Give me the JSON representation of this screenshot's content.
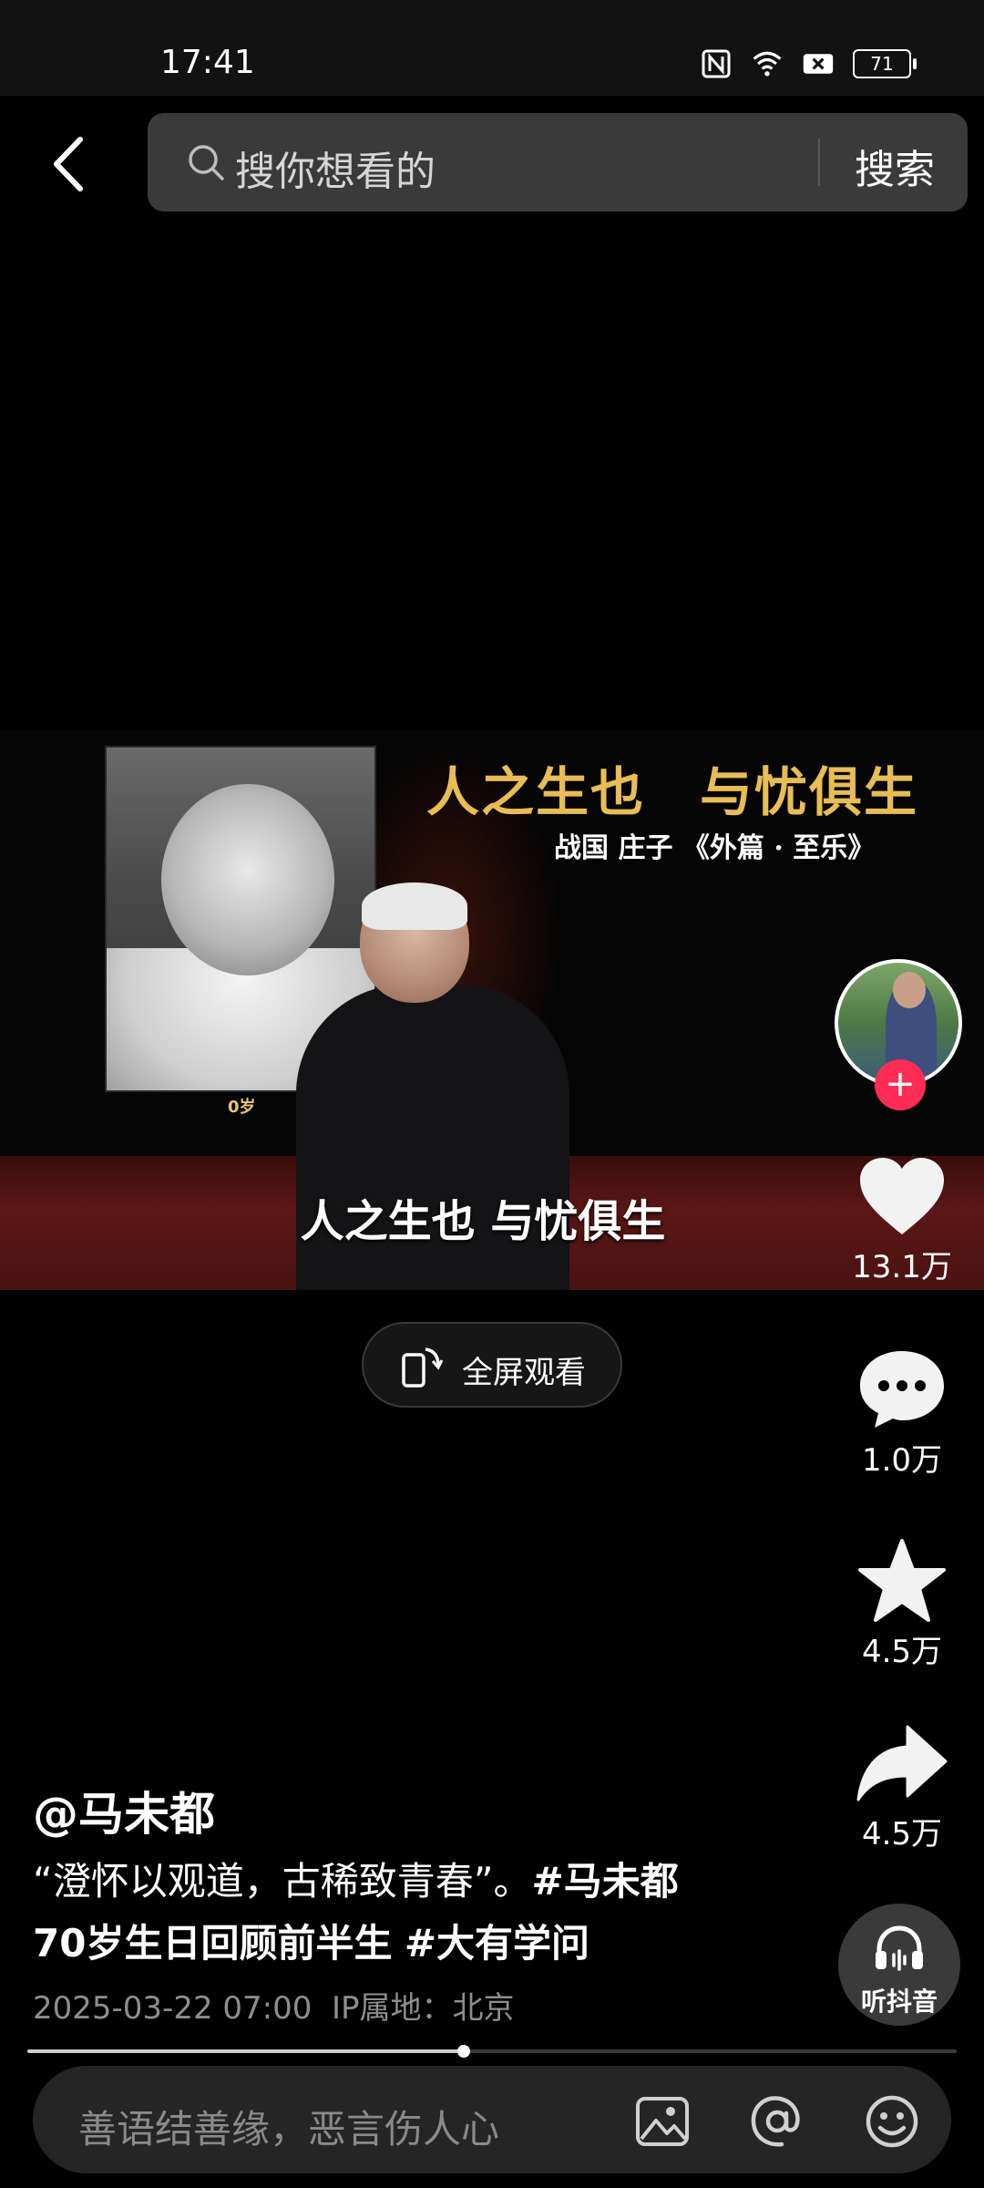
{
  "status": {
    "time": "17:41",
    "battery": "71"
  },
  "search": {
    "placeholder": "搜你想看的",
    "button": "搜索"
  },
  "video": {
    "quote_title": "人之生也　与忧俱生",
    "quote_source": "战国 庄子 《外篇 · 至乐》",
    "photo_age": "0岁",
    "caption": "人之生也 与忧俱生"
  },
  "fullscreen": {
    "label": "全屏观看"
  },
  "rail": {
    "likes": "13.1万",
    "comments": "1.0万",
    "favorites": "4.5万",
    "shares": "4.5万",
    "listen_label": "听抖音"
  },
  "post": {
    "author": "@马未都",
    "desc_text": "“澄怀以观道，古稀致青春”。",
    "tag1": "#马未都",
    "desc_line2_bold": "70岁生日回顾前半生",
    "tag2": "#大有学问",
    "date": "2025-03-22 07:00",
    "ip": "IP属地：北京"
  },
  "progress": {
    "fraction": 0.47
  },
  "comment": {
    "placeholder": "善语结善缘，恶言伤人心"
  },
  "colors": {
    "follow": "#fe2c55",
    "quote_gold": "#e8bd55"
  }
}
